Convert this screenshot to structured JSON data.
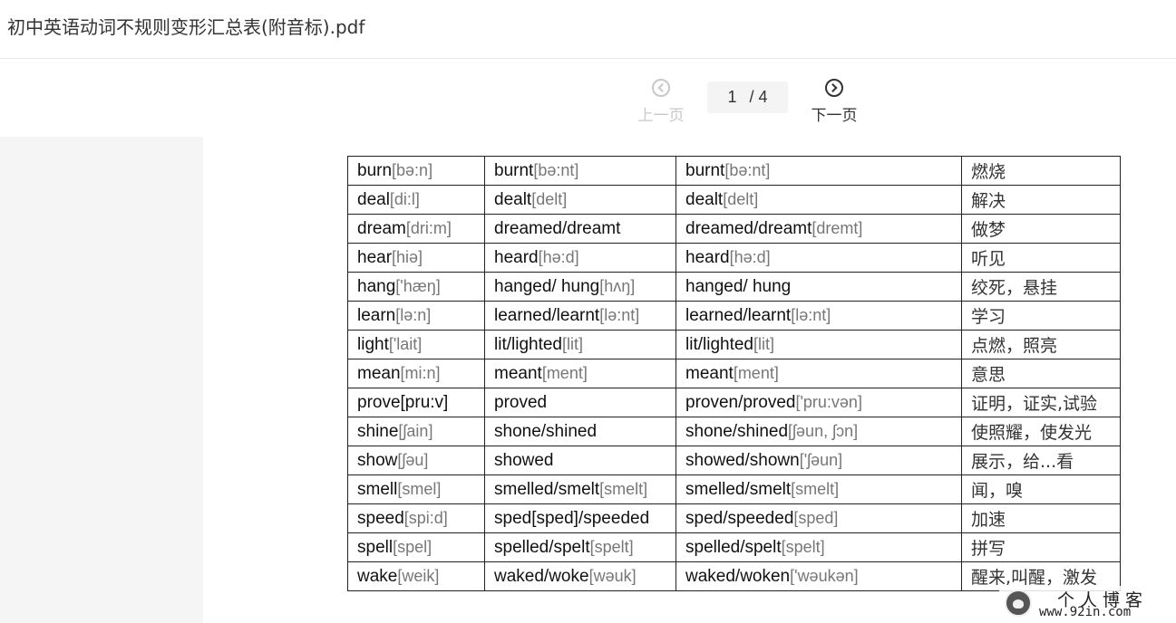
{
  "document": {
    "title": "初中英语动词不规则变形汇总表(附音标).pdf"
  },
  "pager": {
    "prev_label": "上一页",
    "next_label": "下一页",
    "current_page": "1",
    "total_pages": "/ 4",
    "prev_icon": "chevron-left-circle-icon",
    "next_icon": "chevron-right-circle-icon"
  },
  "table": {
    "rows": [
      {
        "base": "burn",
        "base_ph": "[bə:n]",
        "past": "burnt",
        "past_ph": "[bə:nt]",
        "pp": "burnt",
        "pp_ph": "[bə:nt]",
        "meaning": "燃烧"
      },
      {
        "base": "deal",
        "base_ph": "[di:l]",
        "past": "dealt",
        "past_ph": "[delt]",
        "pp": "dealt",
        "pp_ph": "[delt]",
        "meaning": "解决"
      },
      {
        "base": "dream",
        "base_ph": "[dri:m]",
        "past": "dreamed/dreamt",
        "past_ph": "",
        "pp": "dreamed/dreamt",
        "pp_ph": "[dremt]",
        "meaning": "做梦"
      },
      {
        "base": "hear",
        "base_ph": "[hiə]",
        "past": "heard",
        "past_ph": "[hə:d]",
        "pp": "heard",
        "pp_ph": "[hə:d]",
        "meaning": "听见"
      },
      {
        "base": "hang",
        "base_ph": "['hæŋ]",
        "past": "hanged/ hung",
        "past_ph": "[hʌŋ]",
        "pp": "hanged/ hung",
        "pp_ph": "",
        "meaning": "绞死，悬挂"
      },
      {
        "base": "learn",
        "base_ph": "[lə:n]",
        "past": "learned/learnt",
        "past_ph": "[lə:nt]",
        "pp": "learned/learnt",
        "pp_ph": "[lə:nt]",
        "meaning": "学习"
      },
      {
        "base": "light",
        "base_ph": "['lait]",
        "past": "lit/lighted",
        "past_ph": "[lit]",
        "pp": "lit/lighted",
        "pp_ph": "[lit]",
        "meaning": "点燃，照亮"
      },
      {
        "base": "mean",
        "base_ph": "[mi:n]",
        "past": "meant",
        "past_ph": "[ment]",
        "pp": "meant",
        "pp_ph": "[ment]",
        "meaning": "意思"
      },
      {
        "base": "prove[pru:v]",
        "base_ph": "",
        "past": "proved",
        "past_ph": "",
        "pp": "proven/proved",
        "pp_ph": "['pru:vən]",
        "meaning": "证明，证实,试验"
      },
      {
        "base": "shine",
        "base_ph": "[ʃain]",
        "past": "shone/shined",
        "past_ph": "",
        "pp": "shone/shined",
        "pp_ph": "[ʃəun, ʃɔn]",
        "meaning": "使照耀，使发光"
      },
      {
        "base": "show",
        "base_ph": "[ʃəu]",
        "past": "showed",
        "past_ph": "",
        "pp": "showed/shown",
        "pp_ph": "['ʃəun]",
        "meaning": "展示，给...看"
      },
      {
        "base": "smell",
        "base_ph": "[smel]",
        "past": "smelled/smelt",
        "past_ph": "[smelt]",
        "pp": "smelled/smelt",
        "pp_ph": "[smelt]",
        "meaning": "闻，嗅"
      },
      {
        "base": "speed",
        "base_ph": "[spi:d]",
        "past": "sped[sped]/speeded",
        "past_ph": "",
        "pp": "sped/speeded",
        "pp_ph": "[sped]",
        "meaning": "加速"
      },
      {
        "base": "spell",
        "base_ph": "[spel]",
        "past": "spelled/spelt",
        "past_ph": "[spelt]",
        "pp": "spelled/spelt",
        "pp_ph": "[spelt]",
        "meaning": "拼写"
      },
      {
        "base": "wake",
        "base_ph": "[weik]",
        "past": "waked/woke",
        "past_ph": "[wəuk]",
        "pp": "waked/woken",
        "pp_ph": "['wəukən]",
        "meaning": "醒来,叫醒，激发"
      }
    ]
  },
  "watermark": {
    "name": "个人博客",
    "url": "www.92in.com",
    "logo_icon": "blog-avatar-logo"
  }
}
